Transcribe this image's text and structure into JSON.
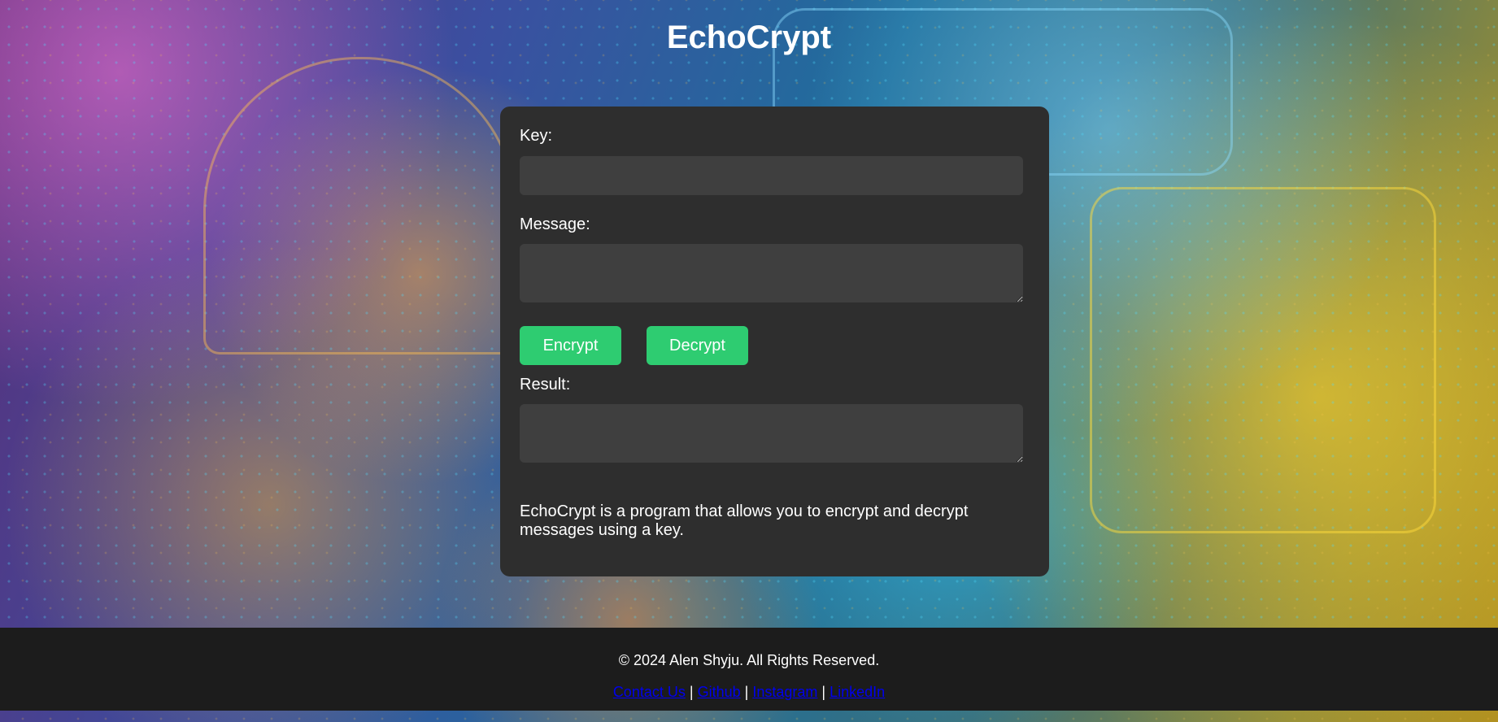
{
  "app": {
    "title": "EchoCrypt"
  },
  "form": {
    "key_label": "Key:",
    "key_value": "",
    "message_label": "Message:",
    "message_value": "",
    "encrypt_label": "Encrypt",
    "decrypt_label": "Decrypt",
    "result_label": "Result:",
    "result_value": "",
    "description": "EchoCrypt is a program that allows you to encrypt and decrypt messages using a key."
  },
  "footer": {
    "copyright": "© 2024 Alen Shyju. All Rights Reserved.",
    "links": [
      {
        "label": "Contact Us"
      },
      {
        "label": "Github"
      },
      {
        "label": "Instagram"
      },
      {
        "label": "LinkedIn"
      }
    ],
    "separator": "|"
  },
  "colors": {
    "accent": "#2ecc71",
    "card_bg": "#2e2e2e",
    "input_bg": "#3f3f3f",
    "footer_bg": "#1c1c1c",
    "link": "#0000ee"
  },
  "background": {
    "image_name": "circuit-padlock-background"
  }
}
